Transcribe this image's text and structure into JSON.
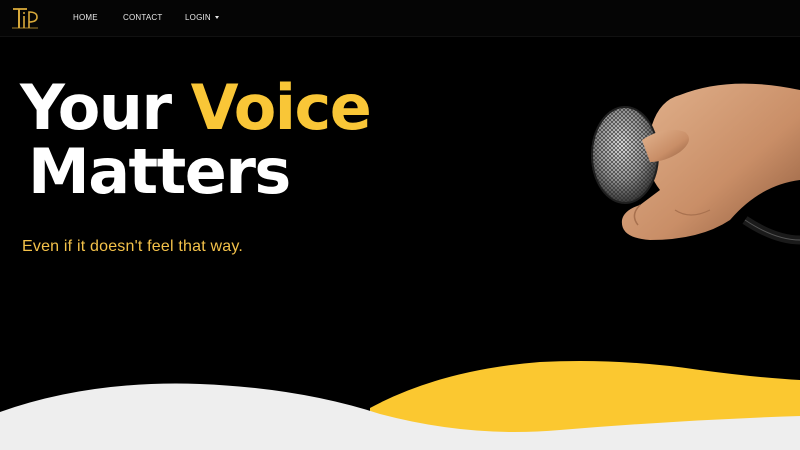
{
  "nav": {
    "logo_text": "TiP",
    "home_label": "HOME",
    "contact_label": "CONTACT",
    "login_label": "LOGIN"
  },
  "hero": {
    "headline_word1": "Your",
    "headline_word2": "Voice",
    "headline_word3": "Matters",
    "tagline": "Even if it doesn't feel that way."
  },
  "colors": {
    "background": "#000000",
    "accent": "#f9c637",
    "wave_light": "#eeeeee",
    "text": "#ffffff"
  },
  "icons": {
    "logo": "tip-logo",
    "login_caret": "caret-down-icon",
    "hero_image": "hand-holding-microphone"
  }
}
